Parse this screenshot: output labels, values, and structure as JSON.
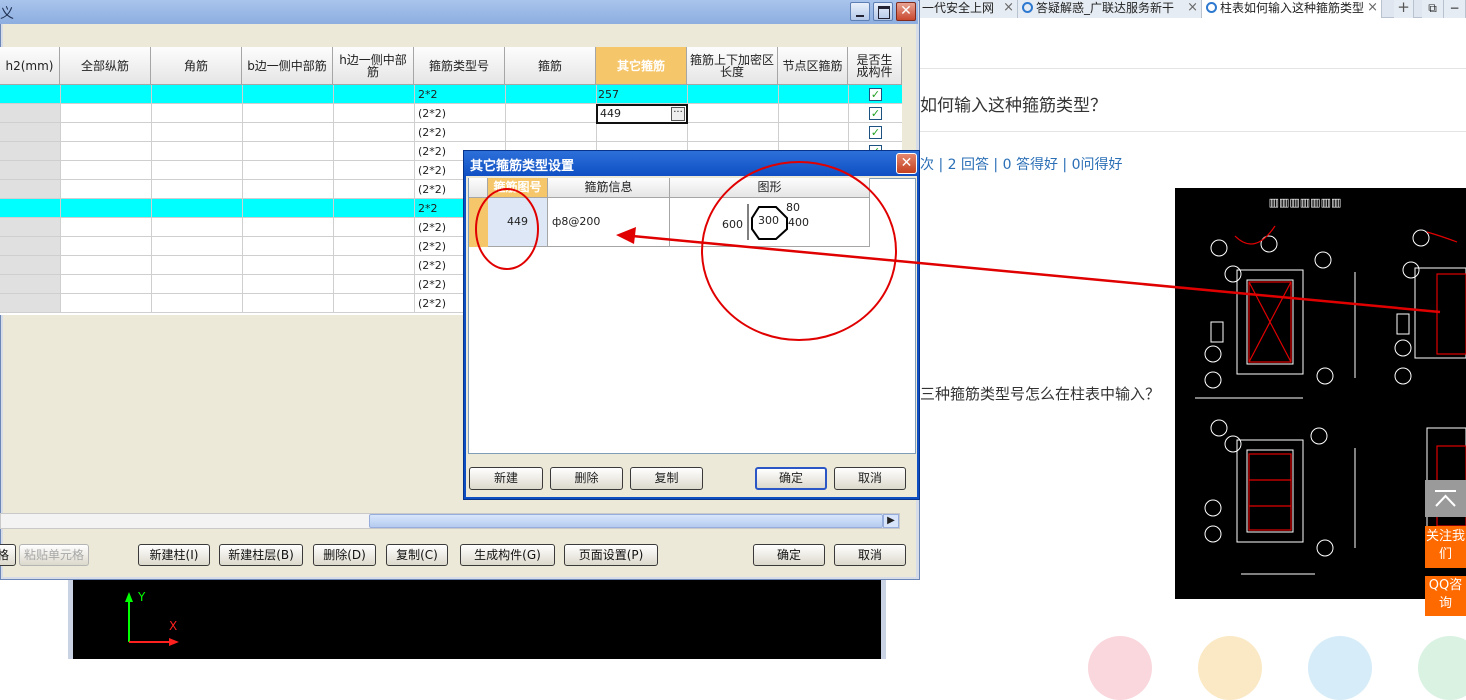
{
  "browser": {
    "tabs": [
      {
        "title": "一代安全上网",
        "active": false
      },
      {
        "title": "答疑解惑_广联达服务新干",
        "active": false
      },
      {
        "title": "柱表如何输入这种箍筋类型",
        "active": true
      }
    ],
    "new_tab_label": "+"
  },
  "page": {
    "question_title": "如何输入这种箍筋类型？",
    "stats": "次 | 2 回答 | 0 答得好 | 0问得好",
    "related_question": "三种箍筋类型号怎么在柱表中输入？",
    "follow_label": "关注我们",
    "qq_label": "QQ咨询"
  },
  "main_window": {
    "title": "义",
    "columns": [
      "h2(mm)",
      "全部纵筋",
      "角筋",
      "b边一侧中部筋",
      "h边一侧中部筋",
      "箍筋类型号",
      "箍筋",
      "其它箍筋",
      "箍筋上下加密区长度",
      "节点区箍筋",
      "是否生成构件"
    ],
    "rows": [
      {
        "type": "2*2",
        "other": "257",
        "highlight": true,
        "checked": true
      },
      {
        "type": "(2*2)",
        "other": "449",
        "highlight": false,
        "checked": true
      },
      {
        "type": "(2*2)",
        "other": "",
        "highlight": false,
        "checked": true
      },
      {
        "type": "(2*2)",
        "other": "",
        "highlight": false,
        "checked": true
      },
      {
        "type": "(2*2)",
        "other": "",
        "highlight": false,
        "checked": false
      },
      {
        "type": "(2*2)",
        "other": "",
        "highlight": false,
        "checked": false
      },
      {
        "type": "2*2",
        "other": "",
        "highlight": true,
        "checked": false
      },
      {
        "type": "(2*2)",
        "other": "",
        "highlight": false,
        "checked": false
      },
      {
        "type": "(2*2)",
        "other": "",
        "highlight": false,
        "checked": false
      },
      {
        "type": "(2*2)",
        "other": "",
        "highlight": false,
        "checked": false
      },
      {
        "type": "(2*2)",
        "other": "",
        "highlight": false,
        "checked": false
      },
      {
        "type": "(2*2)",
        "other": "",
        "highlight": false,
        "checked": false
      }
    ],
    "buttons": {
      "partial_left": "格",
      "paste": "粘贴单元格",
      "new_column": "新建柱(I)",
      "new_column_layer": "新建柱层(B)",
      "delete": "删除(D)",
      "copy": "复制(C)",
      "generate": "生成构件(G)",
      "page_setup": "页面设置(P)",
      "ok": "确定",
      "cancel": "取消"
    },
    "axis_y": "Y",
    "axis_x": "X"
  },
  "dialog": {
    "title": "其它箍筋类型设置",
    "columns": [
      "箍筋图号",
      "箍筋信息",
      "图形"
    ],
    "row": {
      "number": "449",
      "info": "ф8@200",
      "dim_h": "600",
      "dim_inner": "300",
      "dim_top": "80",
      "dim_right": "400"
    },
    "buttons": {
      "new": "新建",
      "delete": "删除",
      "copy": "复制",
      "ok": "确定",
      "cancel": "取消"
    }
  },
  "colors": {
    "cyan_row": "#00ffff",
    "header_highlight": "#f6c66a",
    "dialog_title": "#0d4fc2",
    "annotation": "#e00000",
    "follow": "#ff6a00"
  }
}
